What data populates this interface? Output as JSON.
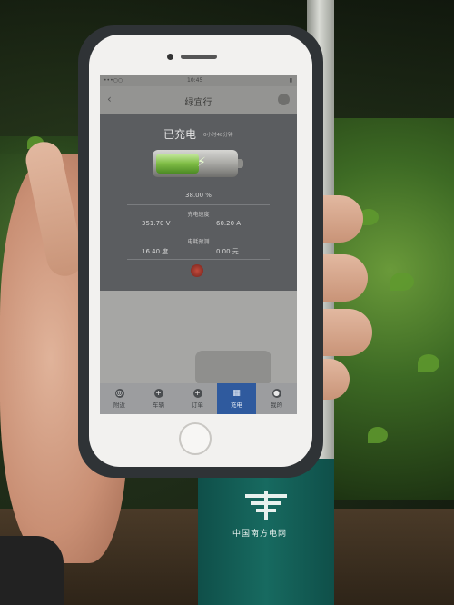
{
  "status_bar": {
    "carrier": "•••○○",
    "time": "10:45",
    "battery": "▮"
  },
  "nav": {
    "title": "绿宜行"
  },
  "charging": {
    "status": "已充电",
    "duration": "0小时48分钟",
    "progress_percent": 38.0,
    "percent_text": "38.00 %",
    "speed_label": "充电速度",
    "voltage": "351.70 V",
    "current": "60.20 A",
    "cost_label": "电耗预测",
    "energy": "16.40 度",
    "amount": "0.00 元"
  },
  "tabs": [
    {
      "label": "附近",
      "icon": "location-icon",
      "glyph": "◎"
    },
    {
      "label": "车辆",
      "icon": "car-icon",
      "glyph": "+"
    },
    {
      "label": "订单",
      "icon": "order-icon",
      "glyph": "+"
    },
    {
      "label": "充电",
      "icon": "charge-grid-icon",
      "glyph": "▦",
      "active": true
    },
    {
      "label": "我的",
      "icon": "profile-icon",
      "glyph": "●"
    }
  ],
  "signage": {
    "brand": "中国南方电网"
  },
  "colors": {
    "panel": "#5b5d60",
    "active_tab": "#2f5a9e",
    "battery_fill": "#7fbd45",
    "stop_button": "#c04a3c",
    "post": "#176a60"
  }
}
